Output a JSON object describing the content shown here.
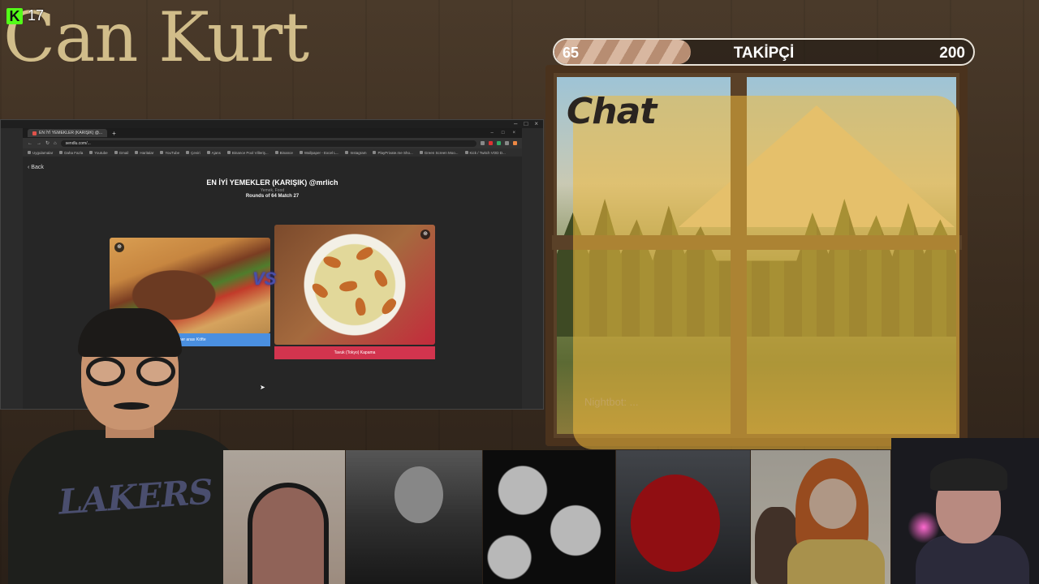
{
  "overlay": {
    "streamer_name": "Can Kurt",
    "viewer_count": "17",
    "follower_goal": {
      "current": "65",
      "label": "TAKİPÇİ",
      "goal": "200",
      "progress_fraction": 0.325
    },
    "chat": {
      "title": "Chat",
      "faded_message": "Nightbot: ..."
    }
  },
  "browser": {
    "tab_title": "EN İYİ YEMEKLER (KARIŞIK) @...",
    "url": "sendlu.com/...",
    "bookmarks": [
      "Uygulamalar",
      "Daha Fazla",
      "Youtube",
      "Gmail",
      "Haritalar",
      "YouTube",
      "Çeviri",
      "Ajans",
      "Binance Pool Villeriş...",
      "Binance",
      "Wallpaper - Excel L...",
      "Instagram",
      "PlayPrivate.me Sho...",
      "Green Screen Moo...",
      "Kick / Twitch VOD D..."
    ],
    "page": {
      "back_label": "Back",
      "title": "EN İYİ YEMEKLER (KARIŞIK) @mrlich",
      "tags": "Yemek, Food",
      "round_info": "Rounds of 64 Match 27",
      "vs_label": "VS",
      "left_choice": "Döner arası Köfte",
      "right_choice": "Tavuk (Tokyo) Kapama"
    }
  },
  "colors": {
    "kick_green": "#53fc18",
    "name_gold": "#d1bd8a",
    "chat_yellow": "#f0b93c",
    "left_button_blue": "#4a8fe0",
    "right_button_red": "#d2344e"
  },
  "icons": {
    "kick": "kick-logo-icon",
    "back": "chevron-left-icon",
    "zoom": "zoom-icon"
  }
}
